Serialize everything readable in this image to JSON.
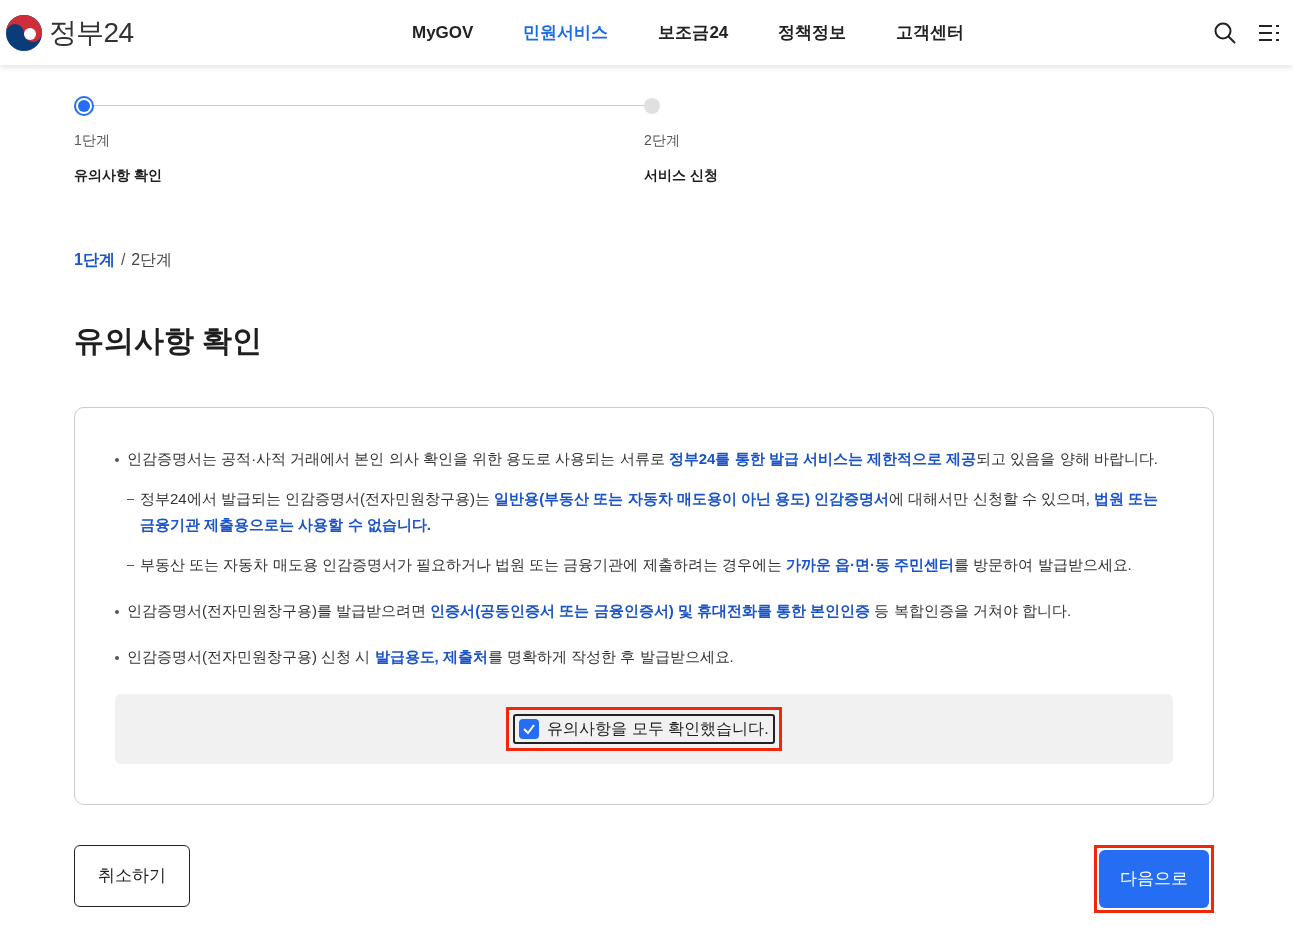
{
  "header": {
    "logo_text": "정부24",
    "nav": [
      {
        "label": "MyGOV",
        "selected": false
      },
      {
        "label": "민원서비스",
        "selected": true
      },
      {
        "label": "보조금24",
        "selected": false
      },
      {
        "label": "정책정보",
        "selected": false
      },
      {
        "label": "고객센터",
        "selected": false
      }
    ]
  },
  "steps": [
    {
      "number": "1단계",
      "label": "유의사항 확인",
      "selected": true
    },
    {
      "number": "2단계",
      "label": "서비스 신청",
      "selected": false
    }
  ],
  "breadcrumb": [
    {
      "label": "1단계",
      "selected": true
    },
    {
      "label": "2단계",
      "selected": false
    }
  ],
  "breadcrumb_separator": "/",
  "title": "유의사항 확인",
  "notices": [
    {
      "text": "인감증명서는 공적·사적 거래에서 본인 의사 확인을 위한 용도로 사용되는 서류로 **정부24를 통한 발급 서비스는 제한적으로 제공**되고 있음을 양해 바랍니다.",
      "children": [
        {
          "text": "정부24에서 발급되는 인감증명서(전자민원창구용)는 **일반용(부동산 또는 자동차 매도용이 아닌 용도) 인감증명서**에 대해서만 신청할 수 있으며, **법원 또는 금융기관 제출용으로는 사용할 수 없습니다.**"
        },
        {
          "text": "부동산 또는 자동차 매도용 인감증명서가 필요하거나 법원 또는 금융기관에 제출하려는 경우에는 **가까운 읍·면·동 주민센터**를 방문하여 발급받으세요."
        }
      ]
    },
    {
      "text": "인감증명서(전자민원창구용)를 발급받으려면 **인증서(공동인증서 또는 금융인증서) 및 휴대전화를 통한 본인인증** 등 복합인증을 거쳐야 합니다."
    },
    {
      "text": "인감증명서(전자민원창구용) 신청 시 **발급용도, 제출처**를 명확하게 작성한 후 발급받으세요."
    }
  ],
  "confirm": {
    "label": "유의사항을 모두 확인했습니다.",
    "checked": true,
    "highlighted": true
  },
  "buttons": [
    {
      "label": "취소하기",
      "kind": "secondary",
      "highlighted": false
    },
    {
      "label": "다음으로",
      "kind": "primary",
      "highlighted": true
    }
  ]
}
